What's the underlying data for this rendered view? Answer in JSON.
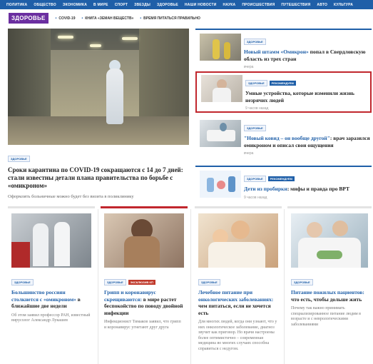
{
  "nav": {
    "items": [
      "Политика",
      "Общество",
      "Экономика",
      "В мире",
      "Спорт",
      "Звезды",
      "Здоровье",
      "Наши новости",
      "Наука",
      "Происшествия",
      "Путешествия",
      "Авто",
      "Культура"
    ]
  },
  "section": {
    "logo": "ЗДОРОВЬЕ",
    "tags": [
      "COVID-19",
      "КНИГА «ЗЕМАН ВЕЩЕСТВ»",
      "ВРЕМЯ ПИТАТЬСЯ ПРАВИЛЬНО"
    ]
  },
  "feature": {
    "category": "ЗДОРОВЬЕ",
    "title": "Сроки карантина по COVID-19 сокращаются с 14 до 7 дней: стали известны детали плана правительства по борьбе с «омикроном»",
    "lead": "Оформлять больничные можно будет без визита в поликлинику"
  },
  "right_items": [
    {
      "category": "ЗДОРОВЬЕ",
      "badge": "",
      "title_hl": "Новый штамм «Омикрон»",
      "title_rest": " попал в Свердловскую область из трех стран",
      "time": "вчера"
    },
    {
      "category": "ЗДОРОВЬЕ",
      "badge": "РЕКОМЕНДУЕМ",
      "title_hl": "",
      "title_rest": "Умные устройства, которые изменили жизнь незрячих людей",
      "time": "9 часов назад"
    },
    {
      "category": "ЗДОРОВЬЕ",
      "badge": "",
      "title_hl": "\"Новый ковид – он вообще другой\"",
      "title_rest": ": врач заразился омикроном и описал свои ощущения",
      "time": "вчера"
    },
    {
      "category": "ЗДОРОВЬЕ",
      "badge": "РЕКОМЕНДУЕМ",
      "title_hl": "Дети из пробирки",
      "title_rest": ": мифы и правда про ВРТ",
      "time": "9 часов назад"
    }
  ],
  "cards": [
    {
      "category": "ЗДОРОВЬЕ",
      "badge": "",
      "title_hl": "Большинство россиян столкнется с «омикроном»",
      "title_rest": " в ближайшие две недели",
      "desc": "Об этом заявил профессор РАН, известный вирусолог Александр Лукашев"
    },
    {
      "category": "ЗДОРОВЬЕ",
      "badge": "ЭКСКЛЮЗИВ КП",
      "title_hl": "Грипп и коронавирус скрещиваются:",
      "title_rest": " в мире растет беспокойство по поводу двойной инфекции",
      "desc": "Инфекционист Тимаков заявил, что грипп и коронавирус угнетают друг друга"
    },
    {
      "category": "ЗДОРОВЬЕ",
      "badge": "",
      "title_hl": "Лечебное питание при онкологических заболеваниях:",
      "title_rest": " чем питаться, если не хочется есть",
      "desc": "Для многих людей, когда они узнают, что у них онкологическое заболевание, диагноз звучит как приговор. Но врачи настроены более оптимистично – современная медицина во многих случаях способна справиться с недугом."
    },
    {
      "category": "ЗДОРОВЬЕ",
      "badge": "",
      "title_hl": "Питание пожилых пациентов:",
      "title_rest": " что есть, чтобы дольше жить",
      "desc": "Почему так важно принимать специализированное питание людям в возрасте и с неврологическими заболеваниями"
    }
  ],
  "colors": {
    "brand": "#1f5fa8",
    "section_logo": "#6b2fa0",
    "highlight_border": "#c1272d",
    "exclusive": "#c0392b"
  }
}
